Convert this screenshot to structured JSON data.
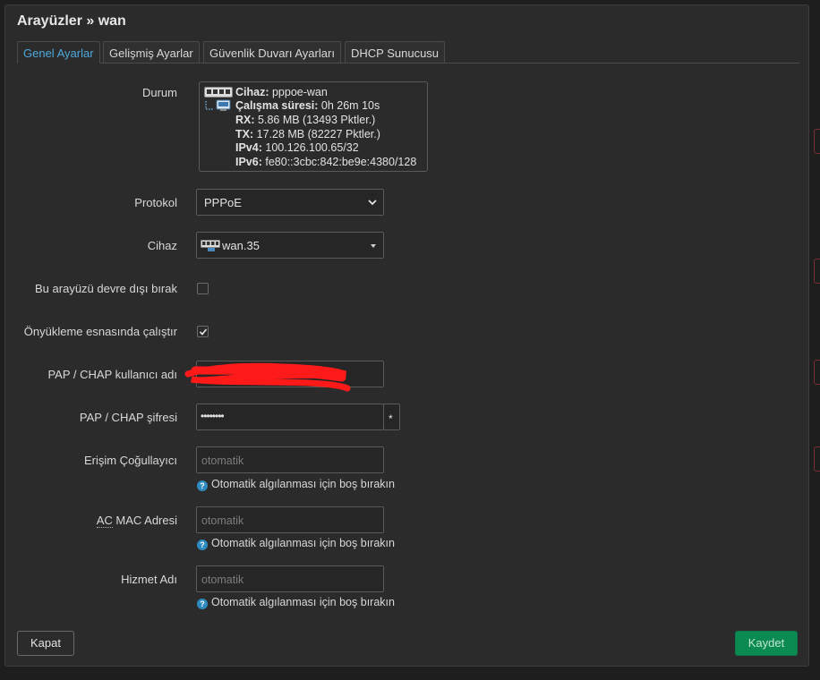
{
  "colors": {
    "accent": "#4fa8dc",
    "save": "#0b8a52",
    "hint_icon": "#2e8bbf",
    "redaction": "#ff1a1a"
  },
  "title": "Arayüzler » wan",
  "tabs": [
    {
      "label": "Genel Ayarlar",
      "active": true
    },
    {
      "label": "Gelişmiş Ayarlar",
      "active": false
    },
    {
      "label": "Güvenlik Duvarı Ayarları",
      "active": false
    },
    {
      "label": "DHCP Sunucusu",
      "active": false
    }
  ],
  "status": {
    "label": "Durum",
    "device_key": "Cihaz:",
    "device_val": "pppoe-wan",
    "uptime_key": "Çalışma süresi:",
    "uptime_val": "0h 26m 10s",
    "rx_key": "RX:",
    "rx_val": "5.86 MB (13493 Pktler.)",
    "tx_key": "TX:",
    "tx_val": "17.28 MB (82227 Pktler.)",
    "ipv4_key": "IPv4:",
    "ipv4_val": "100.126.100.65/32",
    "ipv6_key": "IPv6:",
    "ipv6_val": "fe80::3cbc:842:be9e:4380/128"
  },
  "protocol": {
    "label": "Protokol",
    "value": "PPPoE"
  },
  "device": {
    "label": "Cihaz",
    "value": "wan.35"
  },
  "disable": {
    "label": "Bu arayüzü devre dışı bırak",
    "checked": false
  },
  "bringup": {
    "label": "Önyükleme esnasında çalıştır",
    "checked": true
  },
  "username": {
    "label": "PAP / CHAP kullanıcı adı",
    "value": ""
  },
  "password": {
    "label": "PAP / CHAP şifresi",
    "value": "••••••••",
    "toggle": "*"
  },
  "ac": {
    "label": "Erişim Çoğullayıcı",
    "placeholder": "otomatik",
    "hint": "Otomatik algılanması için boş bırakın"
  },
  "acmac": {
    "label_abbr": "AC",
    "label_rest": " MAC Adresi",
    "placeholder": "otomatik",
    "hint": "Otomatik algılanması için boş bırakın"
  },
  "service": {
    "label": "Hizmet Adı",
    "placeholder": "otomatik",
    "hint": "Otomatik algılanması için boş bırakın"
  },
  "buttons": {
    "close": "Kapat",
    "save": "Kaydet"
  }
}
